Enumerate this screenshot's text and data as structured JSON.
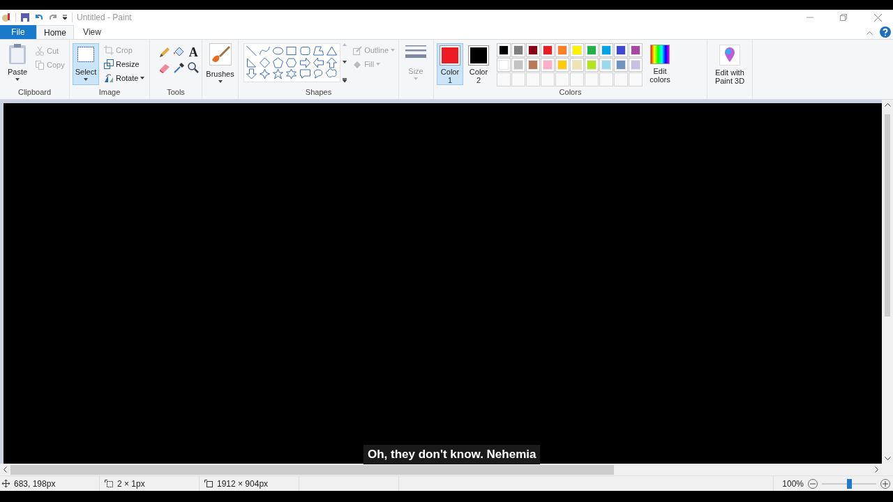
{
  "window": {
    "title": "Untitled - Paint"
  },
  "tabs": [
    {
      "label": "File",
      "kind": "file",
      "selected": false
    },
    {
      "label": "Home",
      "kind": "tab",
      "selected": true
    },
    {
      "label": "View",
      "kind": "tab",
      "selected": false
    }
  ],
  "clipboard": {
    "label": "Clipboard",
    "paste": {
      "label": "Paste",
      "disabled": false
    },
    "cut": {
      "label": "Cut",
      "disabled": true
    },
    "copy": {
      "label": "Copy",
      "disabled": true
    }
  },
  "image": {
    "label": "Image",
    "select": {
      "label": "Select",
      "selected": true
    },
    "crop": {
      "label": "Crop",
      "disabled": true
    },
    "resize": {
      "label": "Resize",
      "disabled": false
    },
    "rotate": {
      "label": "Rotate",
      "disabled": false
    }
  },
  "tools": {
    "label": "Tools",
    "text_tool_glyph": "A"
  },
  "brushes": {
    "label": "Brushes"
  },
  "shapes": {
    "label": "Shapes",
    "outline": {
      "label": "Outline",
      "disabled": true
    },
    "fill": {
      "label": "Fill",
      "disabled": true
    }
  },
  "size": {
    "label": "Size",
    "disabled": true
  },
  "colors": {
    "label": "Colors",
    "color1": {
      "label": "Color\n1",
      "color": "#ed1c24",
      "selected": true
    },
    "color2": {
      "label": "Color\n2",
      "color": "#000000",
      "selected": false
    },
    "palette": [
      {
        "kind": "color",
        "color": "#000000"
      },
      {
        "kind": "color",
        "color": "#7f7f7f"
      },
      {
        "kind": "color",
        "color": "#880015"
      },
      {
        "kind": "color",
        "color": "#ed1c24"
      },
      {
        "kind": "color",
        "color": "#ff7f27"
      },
      {
        "kind": "color",
        "color": "#fff200"
      },
      {
        "kind": "color",
        "color": "#22b14c"
      },
      {
        "kind": "color",
        "color": "#00a2e8"
      },
      {
        "kind": "color",
        "color": "#3f48cc"
      },
      {
        "kind": "color",
        "color": "#a349a4"
      },
      {
        "kind": "color",
        "color": "#ffffff"
      },
      {
        "kind": "color",
        "color": "#c3c3c3"
      },
      {
        "kind": "color",
        "color": "#b97a57"
      },
      {
        "kind": "color",
        "color": "#ffaec9"
      },
      {
        "kind": "color",
        "color": "#ffc90e"
      },
      {
        "kind": "color",
        "color": "#efe4b0"
      },
      {
        "kind": "color",
        "color": "#b5e61d"
      },
      {
        "kind": "color",
        "color": "#99d9ea"
      },
      {
        "kind": "color",
        "color": "#7092be"
      },
      {
        "kind": "color",
        "color": "#c8bfe7"
      },
      {
        "kind": "empty"
      },
      {
        "kind": "empty"
      },
      {
        "kind": "empty"
      },
      {
        "kind": "empty"
      },
      {
        "kind": "empty"
      },
      {
        "kind": "empty"
      },
      {
        "kind": "empty"
      },
      {
        "kind": "empty"
      },
      {
        "kind": "empty"
      },
      {
        "kind": "empty"
      }
    ],
    "edit_colors": "Edit\ncolors"
  },
  "paint3d": {
    "label": "Edit with\nPaint 3D"
  },
  "caption": "Oh, they don't know. Nehemia",
  "status_bar": {
    "cursor": "683, 198px",
    "selection": "2 × 1px",
    "image_size": "1912 × 904px",
    "zoom": "100%",
    "zoom_slider": {
      "level": 0.5
    }
  }
}
